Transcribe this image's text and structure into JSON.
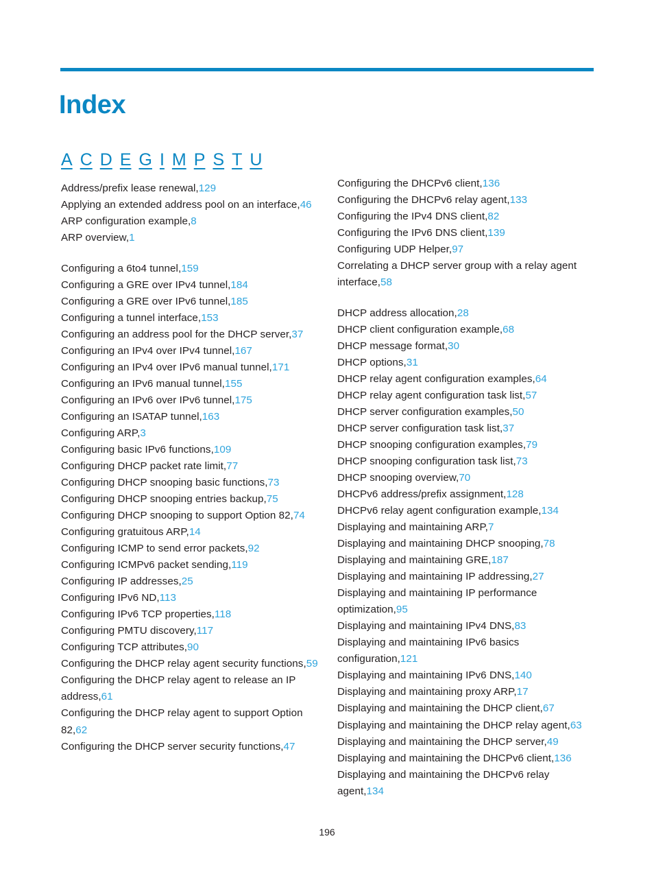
{
  "document": {
    "title": "Index",
    "folio": "196",
    "colors": {
      "heading_blue": "#0b87c3",
      "link_blue": "#2ea4dd",
      "body_text": "#231f20"
    }
  },
  "alpha_nav": {
    "letters": [
      "A",
      "C",
      "D",
      "E",
      "G",
      "I",
      "M",
      "P",
      "S",
      "T",
      "U"
    ]
  },
  "columns": {
    "left": [
      {
        "letter": "A",
        "entries": [
          {
            "text": "Address/prefix lease renewal,",
            "page": "129"
          },
          {
            "text": "Applying an extended address pool on an interface,",
            "page": "46"
          },
          {
            "text": "ARP configuration example,",
            "page": "8"
          },
          {
            "text": "ARP overview,",
            "page": "1"
          }
        ]
      },
      {
        "letter": "C",
        "entries": [
          {
            "text": "Configuring a 6to4 tunnel,",
            "page": "159"
          },
          {
            "text": "Configuring a GRE over IPv4 tunnel,",
            "page": "184"
          },
          {
            "text": "Configuring a GRE over IPv6 tunnel,",
            "page": "185"
          },
          {
            "text": "Configuring a tunnel interface,",
            "page": "153"
          },
          {
            "text": "Configuring an address pool for the DHCP server,",
            "page": "37"
          },
          {
            "text": "Configuring an IPv4 over IPv4 tunnel,",
            "page": "167"
          },
          {
            "text": "Configuring an IPv4 over IPv6 manual tunnel,",
            "page": "171"
          },
          {
            "text": "Configuring an IPv6 manual tunnel,",
            "page": "155"
          },
          {
            "text": "Configuring an IPv6 over IPv6 tunnel,",
            "page": "175"
          },
          {
            "text": "Configuring an ISATAP tunnel,",
            "page": "163"
          },
          {
            "text": "Configuring ARP,",
            "page": "3"
          },
          {
            "text": "Configuring basic IPv6 functions,",
            "page": "109"
          },
          {
            "text": "Configuring DHCP packet rate limit,",
            "page": "77"
          },
          {
            "text": "Configuring DHCP snooping basic functions,",
            "page": "73"
          },
          {
            "text": "Configuring DHCP snooping entries backup,",
            "page": "75"
          },
          {
            "text": "Configuring DHCP snooping to support Option 82,",
            "page": "74"
          },
          {
            "text": "Configuring gratuitous ARP,",
            "page": "14"
          },
          {
            "text": "Configuring ICMP to send error packets,",
            "page": "92"
          },
          {
            "text": "Configuring ICMPv6 packet sending,",
            "page": "119"
          },
          {
            "text": "Configuring IP addresses,",
            "page": "25"
          },
          {
            "text": "Configuring IPv6 ND,",
            "page": "113"
          },
          {
            "text": "Configuring IPv6 TCP properties,",
            "page": "118"
          },
          {
            "text": "Configuring PMTU discovery,",
            "page": "117"
          },
          {
            "text": "Configuring TCP attributes,",
            "page": "90"
          },
          {
            "text": "Configuring the DHCP relay agent security functions,",
            "page": "59"
          },
          {
            "text": "Configuring the DHCP relay agent to release an IP address,",
            "page": "61"
          },
          {
            "text": "Configuring the DHCP relay agent to support Option 82,",
            "page": "62"
          },
          {
            "text": "Configuring the DHCP server security functions,",
            "page": "47"
          }
        ]
      }
    ],
    "right": [
      {
        "letter": "",
        "entries": [
          {
            "text": "Configuring the DHCPv6 client,",
            "page": "136"
          },
          {
            "text": "Configuring the DHCPv6 relay agent,",
            "page": "133"
          },
          {
            "text": "Configuring the IPv4 DNS client,",
            "page": "82"
          },
          {
            "text": "Configuring the IPv6 DNS client,",
            "page": "139"
          },
          {
            "text": "Configuring UDP Helper,",
            "page": "97"
          },
          {
            "text": "Correlating a DHCP server group with a relay agent interface,",
            "page": "58"
          }
        ]
      },
      {
        "letter": "D",
        "entries": [
          {
            "text": "DHCP address allocation,",
            "page": "28"
          },
          {
            "text": "DHCP client configuration example,",
            "page": "68"
          },
          {
            "text": "DHCP message format,",
            "page": "30"
          },
          {
            "text": "DHCP options,",
            "page": "31"
          },
          {
            "text": "DHCP relay agent configuration examples,",
            "page": "64"
          },
          {
            "text": "DHCP relay agent configuration task list,",
            "page": "57"
          },
          {
            "text": "DHCP server configuration examples,",
            "page": "50"
          },
          {
            "text": "DHCP server configuration task list,",
            "page": "37"
          },
          {
            "text": "DHCP snooping configuration examples,",
            "page": "79"
          },
          {
            "text": "DHCP snooping configuration task list,",
            "page": "73"
          },
          {
            "text": "DHCP snooping overview,",
            "page": "70"
          },
          {
            "text": "DHCPv6 address/prefix assignment,",
            "page": "128"
          },
          {
            "text": "DHCPv6 relay agent configuration example,",
            "page": "134"
          },
          {
            "text": "Displaying and maintaining ARP,",
            "page": "7"
          },
          {
            "text": "Displaying and maintaining DHCP snooping,",
            "page": "78"
          },
          {
            "text": "Displaying and maintaining GRE,",
            "page": "187"
          },
          {
            "text": "Displaying and maintaining IP addressing,",
            "page": "27"
          },
          {
            "text": "Displaying and maintaining IP performance optimization,",
            "page": "95"
          },
          {
            "text": "Displaying and maintaining IPv4 DNS,",
            "page": "83"
          },
          {
            "text": "Displaying and maintaining IPv6 basics configuration,",
            "page": "121"
          },
          {
            "text": "Displaying and maintaining IPv6 DNS,",
            "page": "140"
          },
          {
            "text": "Displaying and maintaining proxy ARP,",
            "page": "17"
          },
          {
            "text": "Displaying and maintaining the DHCP client,",
            "page": "67"
          },
          {
            "text": "Displaying and maintaining the DHCP relay agent,",
            "page": "63"
          },
          {
            "text": "Displaying and maintaining the DHCP server,",
            "page": "49"
          },
          {
            "text": "Displaying and maintaining the DHCPv6 client,",
            "page": "136"
          },
          {
            "text": "Displaying and maintaining the DHCPv6 relay agent,",
            "page": "134"
          }
        ]
      }
    ]
  }
}
